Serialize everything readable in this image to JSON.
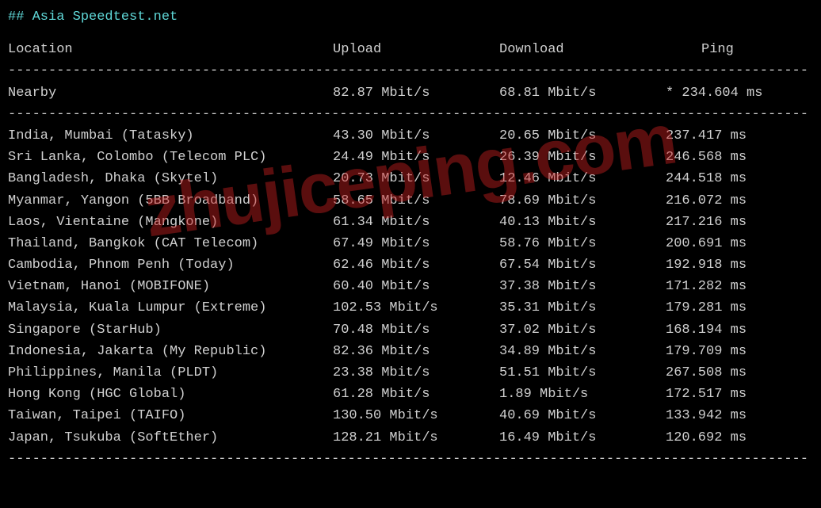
{
  "title_prefix": "##",
  "title_text": "Asia Speedtest.net",
  "headers": {
    "location": "Location",
    "upload": "Upload",
    "download": "Download",
    "ping": "Ping"
  },
  "separator": "---------------------------------------------------------------------------------------------------",
  "nearby": {
    "location": "Nearby",
    "upload": "82.87 Mbit/s",
    "download": "68.81 Mbit/s",
    "ping": "* 234.604 ms"
  },
  "rows": [
    {
      "location": "India, Mumbai (Tatasky)",
      "upload": "43.30 Mbit/s",
      "download": "20.65 Mbit/s",
      "ping": "237.417 ms"
    },
    {
      "location": "Sri Lanka, Colombo (Telecom PLC)",
      "upload": "24.49 Mbit/s",
      "download": "26.39 Mbit/s",
      "ping": "246.568 ms"
    },
    {
      "location": "Bangladesh, Dhaka (Skytel)",
      "upload": "20.73 Mbit/s",
      "download": "12.46 Mbit/s",
      "ping": "244.518 ms"
    },
    {
      "location": "Myanmar, Yangon (5BB Broadband)",
      "upload": "58.65 Mbit/s",
      "download": "78.69 Mbit/s",
      "ping": "216.072 ms"
    },
    {
      "location": "Laos, Vientaine (Mangkone)",
      "upload": "61.34 Mbit/s",
      "download": "40.13 Mbit/s",
      "ping": "217.216 ms"
    },
    {
      "location": "Thailand, Bangkok (CAT Telecom)",
      "upload": "67.49 Mbit/s",
      "download": "58.76 Mbit/s",
      "ping": "200.691 ms"
    },
    {
      "location": "Cambodia, Phnom Penh (Today)",
      "upload": "62.46 Mbit/s",
      "download": "67.54 Mbit/s",
      "ping": "192.918 ms"
    },
    {
      "location": "Vietnam, Hanoi (MOBIFONE)",
      "upload": "60.40 Mbit/s",
      "download": "37.38 Mbit/s",
      "ping": "171.282 ms"
    },
    {
      "location": "Malaysia, Kuala Lumpur (Extreme)",
      "upload": "102.53 Mbit/s",
      "download": "35.31 Mbit/s",
      "ping": "179.281 ms"
    },
    {
      "location": "Singapore (StarHub)",
      "upload": "70.48 Mbit/s",
      "download": "37.02 Mbit/s",
      "ping": "168.194 ms"
    },
    {
      "location": "Indonesia, Jakarta (My Republic)",
      "upload": "82.36 Mbit/s",
      "download": "34.89 Mbit/s",
      "ping": "179.709 ms"
    },
    {
      "location": "Philippines, Manila (PLDT)",
      "upload": "23.38 Mbit/s",
      "download": "51.51 Mbit/s",
      "ping": "267.508 ms"
    },
    {
      "location": "Hong Kong (HGC Global)",
      "upload": "61.28 Mbit/s",
      "download": "1.89 Mbit/s",
      "ping": "172.517 ms"
    },
    {
      "location": "Taiwan, Taipei (TAIFO)",
      "upload": "130.50 Mbit/s",
      "download": "40.69 Mbit/s",
      "ping": "133.942 ms"
    },
    {
      "location": "Japan, Tsukuba (SoftEther)",
      "upload": "128.21 Mbit/s",
      "download": "16.49 Mbit/s",
      "ping": "120.692 ms"
    }
  ],
  "watermark": "zhujiceping.com"
}
